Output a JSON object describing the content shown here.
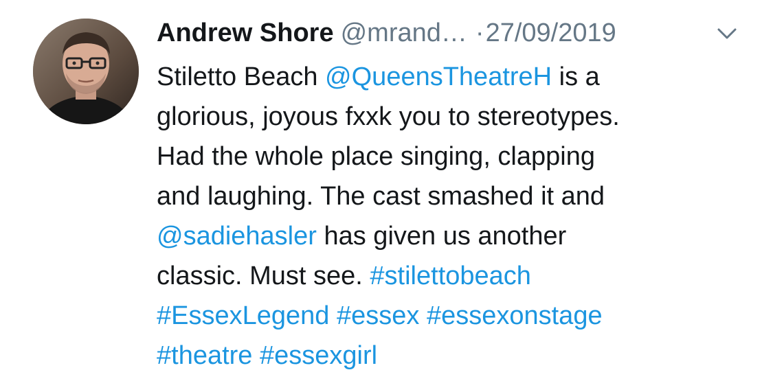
{
  "tweet": {
    "author": {
      "display_name": "Andrew Shore",
      "handle": "@mrand…",
      "avatar_icon": "profile-photo"
    },
    "separator": "·",
    "timestamp": "27/09/2019",
    "menu_icon": "chevron-down-icon",
    "text_lines": [
      [
        {
          "t": "text",
          "v": "Stiletto Beach "
        },
        {
          "t": "mention",
          "v": "@QueensTheatreH"
        },
        {
          "t": "text",
          "v": " is a"
        }
      ],
      [
        {
          "t": "text",
          "v": "glorious, joyous fxxk you to stereotypes."
        }
      ],
      [
        {
          "t": "text",
          "v": "Had the whole place singing, clapping"
        }
      ],
      [
        {
          "t": "text",
          "v": "and laughing. The cast smashed it and"
        }
      ],
      [
        {
          "t": "mention",
          "v": "@sadiehasler"
        },
        {
          "t": "text",
          "v": " has given us another"
        }
      ],
      [
        {
          "t": "text",
          "v": "classic. Must see. "
        },
        {
          "t": "hashtag",
          "v": "#stilettobeach"
        }
      ],
      [
        {
          "t": "hashtag",
          "v": "#EssexLegend"
        },
        {
          "t": "text",
          "v": " "
        },
        {
          "t": "hashtag",
          "v": "#essex"
        },
        {
          "t": "text",
          "v": " "
        },
        {
          "t": "hashtag",
          "v": "#essexonstage"
        }
      ],
      [
        {
          "t": "hashtag",
          "v": "#theatre"
        },
        {
          "t": "text",
          "v": " "
        },
        {
          "t": "hashtag",
          "v": "#essexgirl"
        }
      ]
    ]
  },
  "colors": {
    "text": "#14171a",
    "secondary": "#657786",
    "link": "#1b95e0",
    "background": "#ffffff"
  }
}
